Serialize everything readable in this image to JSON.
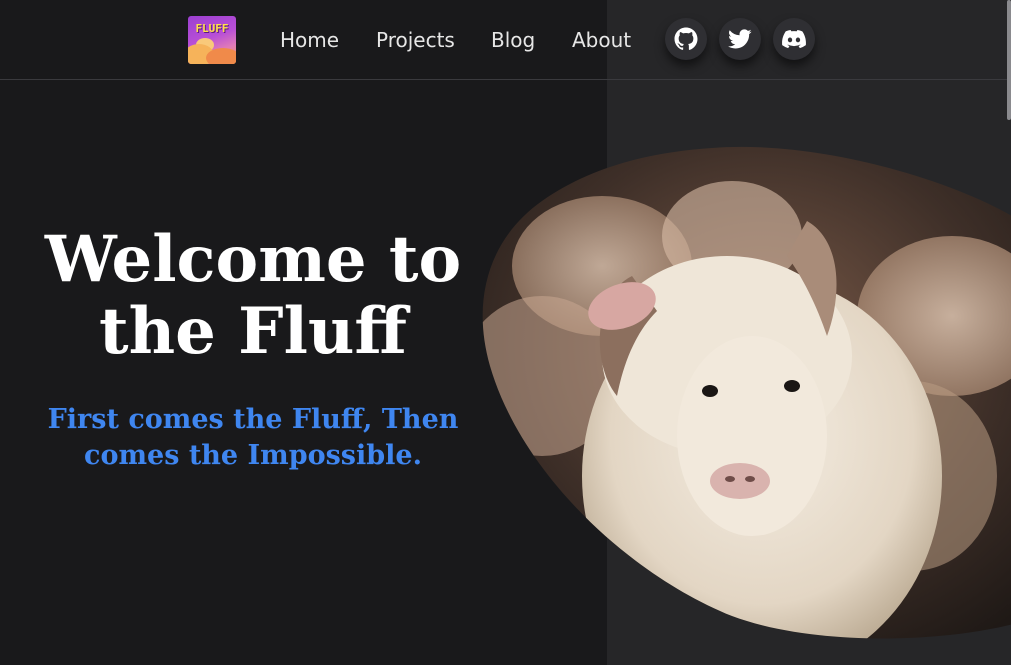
{
  "logo": {
    "text": "FLUFF"
  },
  "nav": {
    "links": [
      {
        "label": "Home"
      },
      {
        "label": "Projects"
      },
      {
        "label": "Blog"
      },
      {
        "label": "About"
      }
    ],
    "social": [
      {
        "icon": "github-icon"
      },
      {
        "icon": "twitter-icon"
      },
      {
        "icon": "discord-icon"
      }
    ]
  },
  "hero": {
    "title_line1": "Welcome to",
    "title_line2": "the Fluff",
    "subtitle_line1": "First comes the Fluff, Then",
    "subtitle_line2": "comes the Impossible."
  },
  "colors": {
    "background": "#19191b",
    "panel": "#262628",
    "accent": "#3f86f0"
  }
}
